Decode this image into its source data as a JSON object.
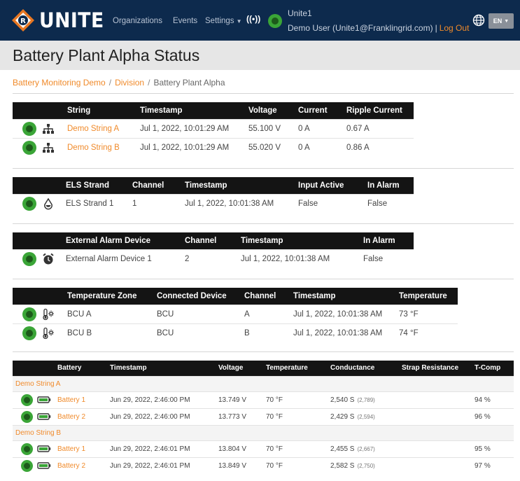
{
  "app": {
    "brand": "UNITE",
    "nav": {
      "organizations": "Organizations",
      "events": "Events",
      "settings": "Settings"
    },
    "user_name": "Unite1",
    "user_info": "Demo User (Unite1@Franklingrid.com)",
    "separator": "|",
    "logout": "Log Out",
    "language": "EN"
  },
  "page": {
    "title": "Battery Plant Alpha Status",
    "breadcrumb": [
      "Battery Monitoring Demo",
      "Division",
      "Battery Plant Alpha"
    ]
  },
  "strings_table": {
    "headers": [
      "String",
      "Timestamp",
      "Voltage",
      "Current",
      "Ripple Current"
    ],
    "rows": [
      {
        "name": "Demo String A",
        "timestamp": "Jul 1, 2022, 10:01:29 AM",
        "voltage": "55.100 V",
        "current": "0 A",
        "ripple": "0.67 A"
      },
      {
        "name": "Demo String B",
        "timestamp": "Jul 1, 2022, 10:01:29 AM",
        "voltage": "55.020 V",
        "current": "0 A",
        "ripple": "0.86 A"
      }
    ]
  },
  "els_table": {
    "headers": [
      "ELS Strand",
      "Channel",
      "Timestamp",
      "Input Active",
      "In Alarm"
    ],
    "rows": [
      {
        "name": "ELS Strand 1",
        "channel": "1",
        "timestamp": "Jul 1, 2022, 10:01:38 AM",
        "input_active": "False",
        "in_alarm": "False"
      }
    ]
  },
  "alarm_table": {
    "headers": [
      "External Alarm Device",
      "Channel",
      "Timestamp",
      "In Alarm"
    ],
    "rows": [
      {
        "name": "External Alarm Device 1",
        "channel": "2",
        "timestamp": "Jul 1, 2022, 10:01:38 AM",
        "in_alarm": "False"
      }
    ]
  },
  "temp_table": {
    "headers": [
      "Temperature Zone",
      "Connected Device",
      "Channel",
      "Timestamp",
      "Temperature"
    ],
    "rows": [
      {
        "zone": "BCU A",
        "device": "BCU",
        "channel": "A",
        "timestamp": "Jul 1, 2022, 10:01:38 AM",
        "temperature": "73 °F"
      },
      {
        "zone": "BCU B",
        "device": "BCU",
        "channel": "B",
        "timestamp": "Jul 1, 2022, 10:01:38 AM",
        "temperature": "74 °F"
      }
    ]
  },
  "battery_table": {
    "headers": [
      "Battery",
      "Timestamp",
      "Voltage",
      "Temperature",
      "Conductance",
      "Strap Resistance",
      "T-Comp"
    ],
    "groups": [
      {
        "name": "Demo String A",
        "rows": [
          {
            "name": "Battery 1",
            "timestamp": "Jun 29, 2022, 2:46:00 PM",
            "voltage": "13.749 V",
            "temperature": "70 °F",
            "conductance": "2,540 S",
            "conductance_sub": "(2,789)",
            "strap": "",
            "tcomp": "94 %"
          },
          {
            "name": "Battery 2",
            "timestamp": "Jun 29, 2022, 2:46:00 PM",
            "voltage": "13.773 V",
            "temperature": "70 °F",
            "conductance": "2,429 S",
            "conductance_sub": "(2,594)",
            "strap": "",
            "tcomp": "96 %"
          }
        ]
      },
      {
        "name": "Demo String B",
        "rows": [
          {
            "name": "Battery 1",
            "timestamp": "Jun 29, 2022, 2:46:01 PM",
            "voltage": "13.804 V",
            "temperature": "70 °F",
            "conductance": "2,455 S",
            "conductance_sub": "(2,667)",
            "strap": "",
            "tcomp": "95 %"
          },
          {
            "name": "Battery 2",
            "timestamp": "Jun 29, 2022, 2:46:01 PM",
            "voltage": "13.849 V",
            "temperature": "70 °F",
            "conductance": "2,582 S",
            "conductance_sub": "(2,750)",
            "strap": "",
            "tcomp": "97 %"
          }
        ]
      }
    ]
  },
  "colors": {
    "navbar": "#0d2a4d",
    "accent": "#f08a2a",
    "status_ok": "#3aa537",
    "header_bg": "#141414"
  }
}
